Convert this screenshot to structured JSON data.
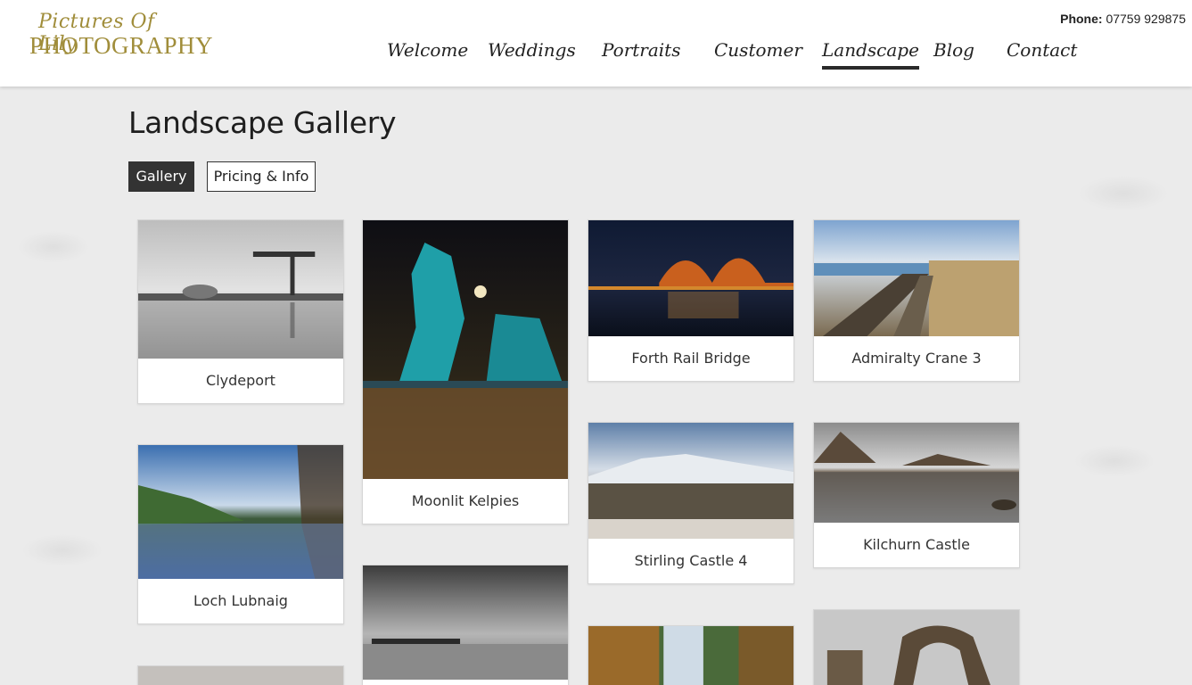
{
  "brand": {
    "logo_script": "Pictures Of Lily",
    "logo_main": "PHOTOGRAPHY"
  },
  "contact": {
    "phone_label": "Phone:",
    "phone_number": "07759 929875"
  },
  "nav": {
    "items": [
      {
        "label": "Welcome"
      },
      {
        "label": "Weddings"
      },
      {
        "label": "Portraits"
      },
      {
        "label": "Customer"
      },
      {
        "label": "Landscape",
        "active": true
      },
      {
        "label": "Blog"
      },
      {
        "label": "Contact"
      }
    ]
  },
  "page": {
    "title": "Landscape Gallery"
  },
  "tabs": {
    "gallery": "Gallery",
    "pricing": "Pricing & Info"
  },
  "gallery": {
    "items": [
      {
        "caption": "Clydeport"
      },
      {
        "caption": "Moonlit Kelpies"
      },
      {
        "caption": "Forth Rail Bridge"
      },
      {
        "caption": "Admiralty Crane 3"
      },
      {
        "caption": "Loch Lubnaig"
      },
      {
        "caption": "Stirling Castle 4"
      },
      {
        "caption": "Kilchurn Castle"
      }
    ]
  },
  "colors": {
    "brand_gold": "#a08d3a",
    "dark": "#333333",
    "header_bg": "#ffffff"
  }
}
